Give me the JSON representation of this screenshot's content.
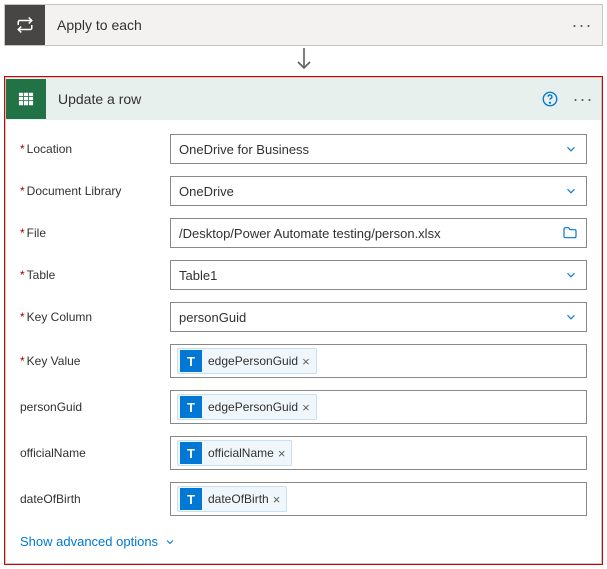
{
  "apply_card": {
    "title": "Apply to each"
  },
  "excel_card": {
    "title": "Update a row",
    "rows": {
      "location": {
        "label": "Location",
        "value": "OneDrive for Business"
      },
      "document_library": {
        "label": "Document Library",
        "value": "OneDrive"
      },
      "file": {
        "label": "File",
        "value": "/Desktop/Power Automate testing/person.xlsx"
      },
      "table": {
        "label": "Table",
        "value": "Table1"
      },
      "key_column": {
        "label": "Key Column",
        "value": "personGuid"
      },
      "key_value": {
        "label": "Key Value",
        "token": "edgePersonGuid"
      },
      "personGuid": {
        "label": "personGuid",
        "token": "edgePersonGuid"
      },
      "officialName": {
        "label": "officialName",
        "token": "officialName"
      },
      "dateOfBirth": {
        "label": "dateOfBirth",
        "token": "dateOfBirth"
      }
    },
    "advanced_link": "Show advanced options"
  },
  "glyphs": {
    "T": "T",
    "x": "×",
    "dots": "···"
  }
}
